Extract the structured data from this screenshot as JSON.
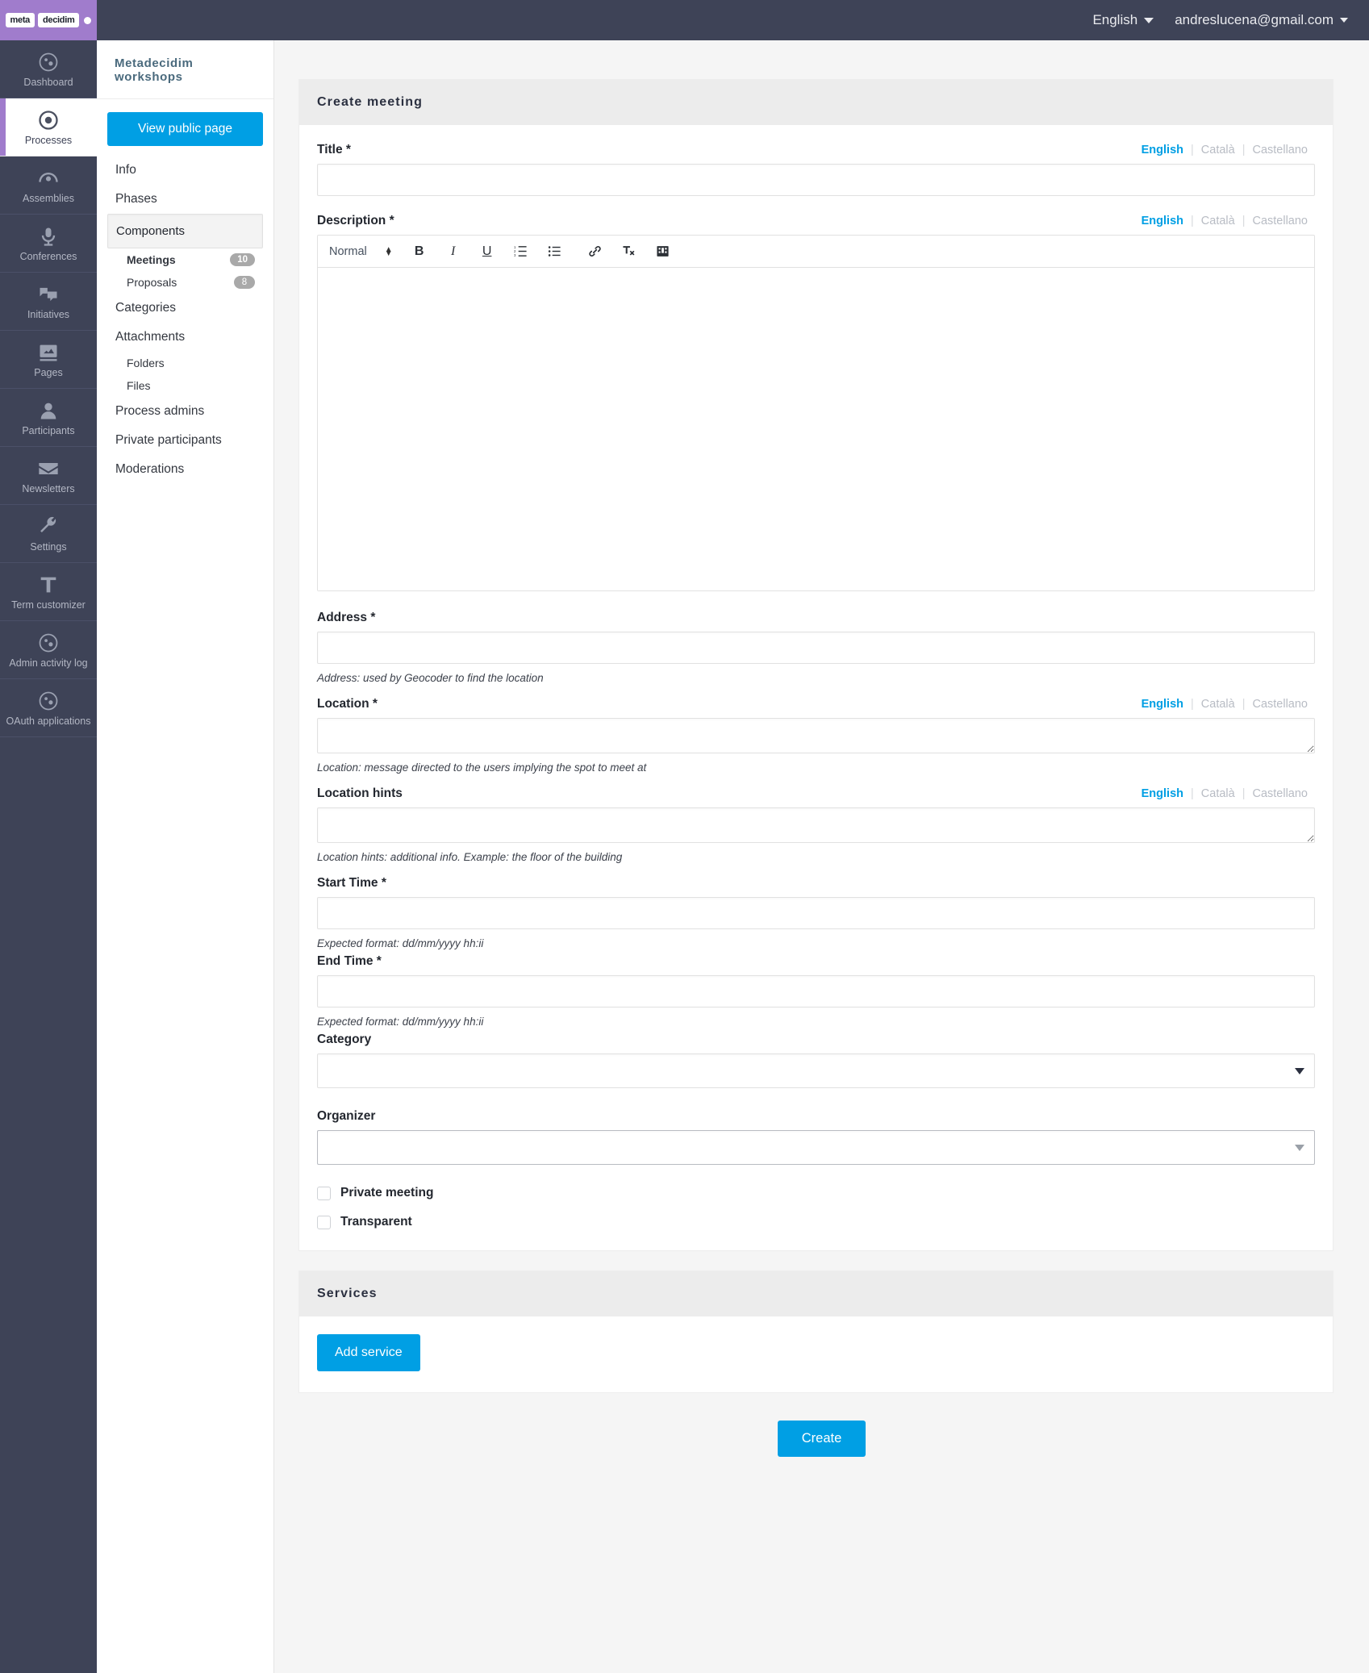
{
  "topbar": {
    "brand": {
      "word1": "meta",
      "word2": "decidim"
    },
    "language": "English",
    "user_email": "andreslucena@gmail.com"
  },
  "sidebar": {
    "items": [
      {
        "label": "Dashboard",
        "icon": "globe-icon",
        "active": false
      },
      {
        "label": "Processes",
        "icon": "target-icon",
        "active": true
      },
      {
        "label": "Assemblies",
        "icon": "assembly-icon",
        "active": false
      },
      {
        "label": "Conferences",
        "icon": "microphone-icon",
        "active": false
      },
      {
        "label": "Initiatives",
        "icon": "speech-bubble-icon",
        "active": false
      },
      {
        "label": "Pages",
        "icon": "book-icon",
        "active": false
      },
      {
        "label": "Participants",
        "icon": "person-icon",
        "active": false
      },
      {
        "label": "Newsletters",
        "icon": "envelope-icon",
        "active": false
      },
      {
        "label": "Settings",
        "icon": "wrench-icon",
        "active": false
      },
      {
        "label": "Term customizer",
        "icon": "text-t-icon",
        "active": false
      },
      {
        "label": "Admin activity log",
        "icon": "globe-icon",
        "active": false
      },
      {
        "label": "OAuth applications",
        "icon": "globe-icon",
        "active": false
      }
    ]
  },
  "secondary_nav": {
    "process_title": "Metadecidim workshops",
    "view_public_page": "View public page",
    "items": [
      {
        "label": "Info",
        "type": "item",
        "selected": false
      },
      {
        "label": "Phases",
        "type": "item",
        "selected": false
      },
      {
        "label": "Components",
        "type": "item",
        "selected": true
      },
      {
        "label": "Meetings",
        "type": "sub",
        "bold": true,
        "badge": "10"
      },
      {
        "label": "Proposals",
        "type": "sub",
        "bold": false,
        "badge": "8"
      },
      {
        "label": "Categories",
        "type": "item",
        "selected": false
      },
      {
        "label": "Attachments",
        "type": "item",
        "selected": false
      },
      {
        "label": "Folders",
        "type": "sub",
        "bold": false,
        "badge": ""
      },
      {
        "label": "Files",
        "type": "sub",
        "bold": false,
        "badge": ""
      },
      {
        "label": "Process admins",
        "type": "item",
        "selected": false
      },
      {
        "label": "Private participants",
        "type": "item",
        "selected": false
      },
      {
        "label": "Moderations",
        "type": "item",
        "selected": false
      }
    ]
  },
  "form": {
    "card_title": "Create meeting",
    "langs": {
      "a": "English",
      "b": "Català",
      "c": "Castellano"
    },
    "title": {
      "label": "Title",
      "required": "*",
      "value": ""
    },
    "description": {
      "label": "Description",
      "required": "*",
      "value": ""
    },
    "editor": {
      "format": "Normal",
      "bold": "B",
      "italic": "I",
      "underline": "U",
      "ordered_list": "ordered-list-icon",
      "bullet_list": "bullet-list-icon",
      "link": "link-icon",
      "clear_format": "clear-format-icon",
      "video": "video-icon"
    },
    "address": {
      "label": "Address",
      "required": "*",
      "value": "",
      "hint": "Address: used by Geocoder to find the location"
    },
    "location": {
      "label": "Location",
      "required": "*",
      "value": "",
      "hint": "Location: message directed to the users implying the spot to meet at"
    },
    "location_hints": {
      "label": "Location hints",
      "value": "",
      "hint": "Location hints: additional info. Example: the floor of the building"
    },
    "start_time": {
      "label": "Start Time",
      "required": "*",
      "value": "",
      "hint": "Expected format: dd/mm/yyyy hh:ii"
    },
    "end_time": {
      "label": "End Time",
      "required": "*",
      "value": "",
      "hint": "Expected format: dd/mm/yyyy hh:ii"
    },
    "category": {
      "label": "Category",
      "value": "",
      "options": [
        ""
      ]
    },
    "organizer": {
      "label": "Organizer",
      "value": "",
      "options": [
        ""
      ]
    },
    "private_meeting": {
      "label": "Private meeting",
      "checked": false
    },
    "transparent": {
      "label": "Transparent",
      "checked": false
    }
  },
  "services": {
    "card_title": "Services",
    "add_service": "Add service"
  },
  "submit": {
    "create": "Create"
  },
  "colors": {
    "accent": "#009fe4",
    "topbar": "#3e4357",
    "brand": "#a07ccc",
    "card_head": "#ececec",
    "page_bg": "#f5f5f5"
  }
}
